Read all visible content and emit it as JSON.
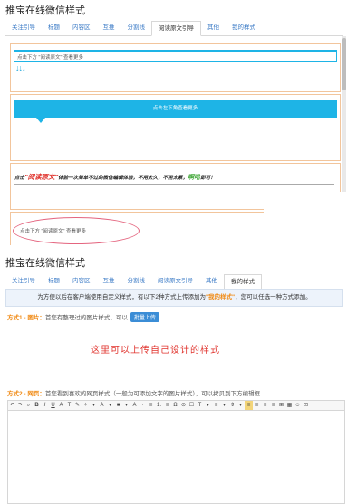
{
  "panel1": {
    "title": "推宝在线微信样式",
    "tabs": [
      "关注引导",
      "标题",
      "内容区",
      "互推",
      "分割线",
      "阅读原文引导",
      "其他",
      "我的样式"
    ],
    "active_tab_index": 5,
    "card1_text": "点击下方 \"阅读原文\" 查看更多",
    "card1_arrows": "↓↓↓",
    "card2_text": "点击左下角查看更多",
    "card3_prefix": "点击",
    "card3_highlight": "\"阅读原文\"",
    "card3_middle": "体验一次简单不过的微信编辑体验，不用太久，不用太累，",
    "card3_green": "啊哈",
    "card3_suffix": "即可！",
    "card4_text": "点击下方 \"阅读原文\" 查看更多"
  },
  "panel2": {
    "title": "推宝在线微信样式",
    "tabs": [
      "关注引导",
      "标题",
      "内容区",
      "互推",
      "分割线",
      "阅读原文引导",
      "其他",
      "我的样式"
    ],
    "active_tab_index": 7,
    "banner_prefix": "为方便以后在客户端使用自定义样式，有以下2种方式上传添加为",
    "banner_highlight": "\"我的样式\"",
    "banner_suffix": "，您可以任选一种方式添加。",
    "method1_label": "方式1 - 图片：",
    "method1_text": "首您有整理过的图片样式，可以",
    "upload_button": "批量上传",
    "annotation": "这里可以上传自己设计的样式",
    "method2_label": "方式2 - 网页：",
    "method2_text": "首您看到喜欢的网页样式（一般为可添加文字的图片样式），可以拷贝到下方编辑框",
    "toolbar": [
      "↶",
      "↷",
      "⌕",
      "B",
      "I",
      "U",
      "A",
      "T",
      "✎",
      "✧",
      "▾",
      "A",
      "▾",
      "■",
      "▾",
      "A",
      "·",
      "≡",
      "1.",
      "≡",
      "Ω",
      "⊙",
      "☐",
      "T",
      "▾",
      "≡",
      "▾",
      "⇕",
      "▾",
      "≡",
      "≡",
      "≡",
      "≡",
      "⊞",
      "▦",
      "☺",
      "⊡"
    ],
    "toolbar_active_index": 29
  },
  "colors": {
    "tab_link": "#3a7ac6",
    "accent_blue": "#1eb4e6",
    "highlight_orange": "#f08a14",
    "annotation_red": "#e0322c",
    "card_border": "#f2c59c"
  }
}
